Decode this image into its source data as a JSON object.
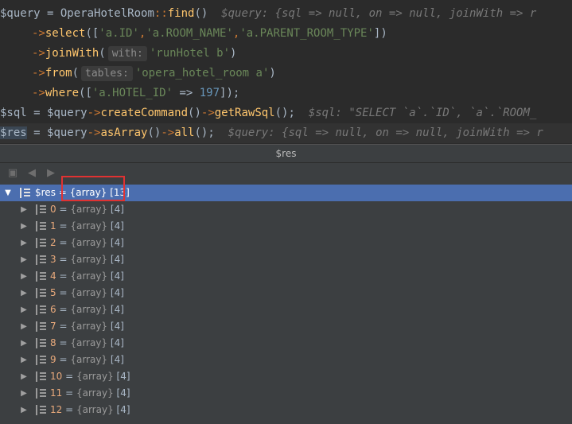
{
  "code": {
    "line1": {
      "var": "$query",
      "eq": " = ",
      "cls": "OperaHotelRoom",
      "sep": "::",
      "fn": "find",
      "paren": "()",
      "hint": "  $query: {sql => null, on => null, joinWith => r"
    },
    "line2": {
      "arrow": "->",
      "fn": "select",
      "open": "([",
      "s1": "'a.ID'",
      "c1": ",",
      "s2": "'a.ROOM_NAME'",
      "c2": ",",
      "s3": "'a.PARENT_ROOM_TYPE'",
      "close": "])"
    },
    "line3": {
      "arrow": "->",
      "fn": "joinWith",
      "open": "(",
      "hint": "with:",
      "str": "'runHotel b'",
      "close": ")"
    },
    "line4": {
      "arrow": "->",
      "fn": "from",
      "open": "(",
      "hint": "tables:",
      "str": "'opera_hotel_room a'",
      "close": ")"
    },
    "line5": {
      "arrow": "->",
      "fn": "where",
      "open": "([",
      "str": "'a.HOTEL_ID'",
      "op": " => ",
      "num": "197",
      "close": "]);"
    },
    "line6": {
      "var": "$sql",
      "eq": " = ",
      "var2": "$query",
      "arrow": "->",
      "fn1": "createCommand",
      "p1": "()",
      "arrow2": "->",
      "fn2": "getRawSql",
      "p2": "();",
      "hint": "  $sql: \"SELECT `a`.`ID`, `a`.`ROOM_"
    },
    "line7": {
      "var": "$res",
      "eq": " = ",
      "var2": "$query",
      "arrow": "->",
      "fn1": "asArray",
      "p1": "()",
      "arrow2": "->",
      "fn2": "all",
      "p2": "();",
      "hint": "  $query: {sql => null, on => null, joinWith => r"
    }
  },
  "panel": {
    "title": "$res",
    "toolbar": [
      "restore-icon",
      "back-icon",
      "forward-icon"
    ]
  },
  "tree": {
    "root": {
      "key": "$res",
      "eq": " = ",
      "type": "{array}",
      "count": "[13]"
    },
    "items": [
      {
        "key": "0",
        "eq": " = ",
        "type": "{array}",
        "count": "[4]"
      },
      {
        "key": "1",
        "eq": " = ",
        "type": "{array}",
        "count": "[4]"
      },
      {
        "key": "2",
        "eq": " = ",
        "type": "{array}",
        "count": "[4]"
      },
      {
        "key": "3",
        "eq": " = ",
        "type": "{array}",
        "count": "[4]"
      },
      {
        "key": "4",
        "eq": " = ",
        "type": "{array}",
        "count": "[4]"
      },
      {
        "key": "5",
        "eq": " = ",
        "type": "{array}",
        "count": "[4]"
      },
      {
        "key": "6",
        "eq": " = ",
        "type": "{array}",
        "count": "[4]"
      },
      {
        "key": "7",
        "eq": " = ",
        "type": "{array}",
        "count": "[4]"
      },
      {
        "key": "8",
        "eq": " = ",
        "type": "{array}",
        "count": "[4]"
      },
      {
        "key": "9",
        "eq": " = ",
        "type": "{array}",
        "count": "[4]"
      },
      {
        "key": "10",
        "eq": " = ",
        "type": "{array}",
        "count": "[4]"
      },
      {
        "key": "11",
        "eq": " = ",
        "type": "{array}",
        "count": "[4]"
      },
      {
        "key": "12",
        "eq": " = ",
        "type": "{array}",
        "count": "[4]"
      }
    ]
  },
  "colors": {
    "selection": "#4b6eaf",
    "highlight_box": "#e03232",
    "key_color": "#e8a97b"
  }
}
